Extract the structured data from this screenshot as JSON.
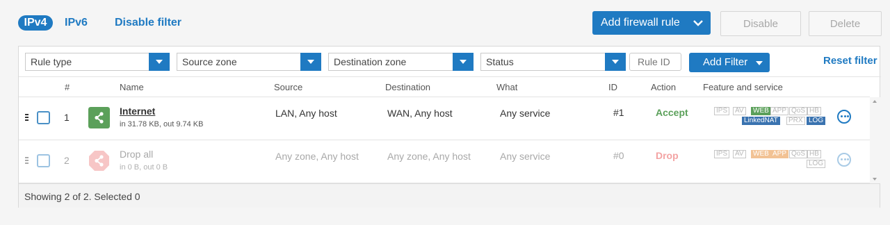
{
  "tabs": {
    "ipv4": "IPv4",
    "ipv6": "IPv6",
    "disable_filter": "Disable filter"
  },
  "toolbar": {
    "add_rule": "Add firewall rule",
    "disable": "Disable",
    "delete": "Delete"
  },
  "filters": {
    "rule_type": "Rule type",
    "source_zone": "Source zone",
    "destination_zone": "Destination zone",
    "status": "Status",
    "rule_id_placeholder": "Rule ID",
    "add_filter": "Add Filter",
    "reset_filter": "Reset filter"
  },
  "columns": [
    "#",
    "Name",
    "Source",
    "Destination",
    "What",
    "ID",
    "Action",
    "Feature and service"
  ],
  "rows": [
    {
      "num": "1",
      "name": "Internet",
      "traffic": "in 31.78 KB, out 9.74 KB",
      "source": "LAN, Any host",
      "destination": "WAN, Any host",
      "what": "Any service",
      "id": "#1",
      "action": "Accept",
      "tags": [
        "IPS",
        "AV",
        "WEB",
        "APP",
        "QoS",
        "HB",
        "LinkedNAT",
        "PRX",
        "LOG"
      ]
    },
    {
      "num": "2",
      "name": "Drop all",
      "traffic": "in 0 B, out 0 B",
      "source": "Any zone, Any host",
      "destination": "Any zone, Any host",
      "what": "Any service",
      "id": "#0",
      "action": "Drop",
      "tags": [
        "IPS",
        "AV",
        "WEB",
        "APP",
        "QoS",
        "HB",
        "LOG"
      ]
    }
  ],
  "footer": {
    "status": "Showing 2 of 2. Selected 0"
  },
  "colors": {
    "accent": "#1f7ac2",
    "accept": "#5ba05a",
    "drop": "#f3a3a3"
  }
}
